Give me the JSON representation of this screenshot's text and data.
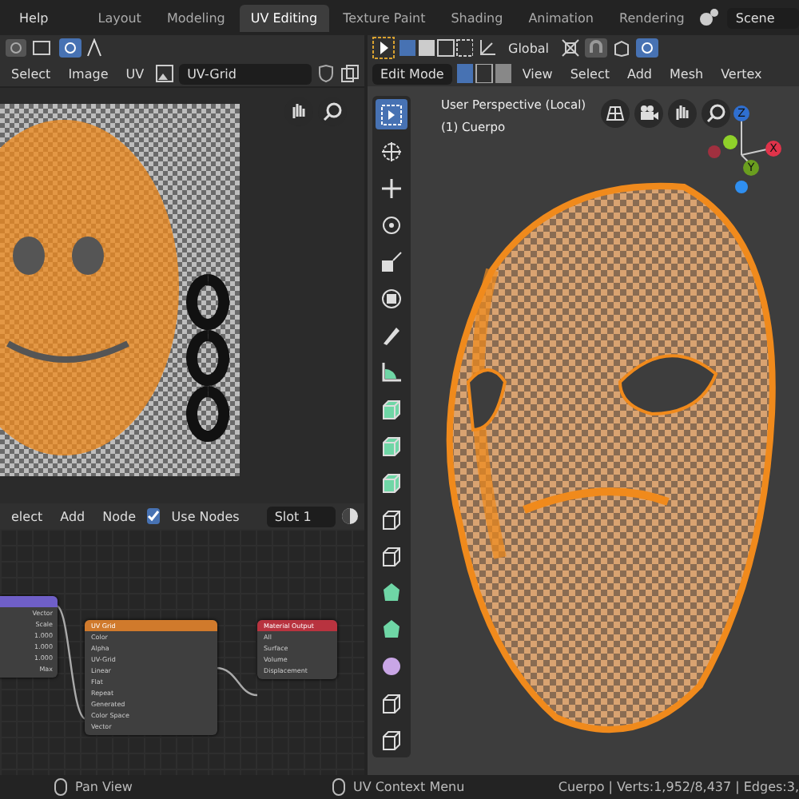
{
  "top_menu": "Help",
  "tabs": [
    {
      "label": "Layout",
      "selected": false
    },
    {
      "label": "Modeling",
      "selected": false
    },
    {
      "label": "UV Editing",
      "selected": true
    },
    {
      "label": "Texture Paint",
      "selected": false
    },
    {
      "label": "Shading",
      "selected": false
    },
    {
      "label": "Animation",
      "selected": false
    },
    {
      "label": "Rendering",
      "selected": false
    }
  ],
  "scene": "Scene",
  "uv_editor": {
    "menu": [
      "Select",
      "Image",
      "UV"
    ],
    "image_name": "UV-Grid"
  },
  "viewport": {
    "mode": "Edit Mode",
    "transform": "Global",
    "menu": [
      "View",
      "Select",
      "Add",
      "Mesh",
      "Vertex"
    ],
    "view_name": "User Perspective (Local)",
    "object": "(1) Cuerpo",
    "axes": [
      "Z",
      "X",
      "Y"
    ],
    "tools": [
      {
        "kind": "select",
        "selected": true
      },
      {
        "kind": "cursor",
        "selected": false
      },
      {
        "kind": "move",
        "selected": false
      },
      {
        "kind": "rotate",
        "selected": false
      },
      {
        "kind": "scale",
        "selected": false
      },
      {
        "kind": "transform",
        "selected": false
      },
      {
        "kind": "annotate",
        "selected": false
      },
      {
        "kind": "measure",
        "selected": false
      },
      {
        "kind": "extrude",
        "selected": false
      },
      {
        "kind": "inset",
        "selected": false
      },
      {
        "kind": "bevel",
        "selected": false
      },
      {
        "kind": "loopcut",
        "selected": false
      },
      {
        "kind": "knife",
        "selected": false
      },
      {
        "kind": "polybuild",
        "selected": false
      },
      {
        "kind": "spin",
        "selected": false
      },
      {
        "kind": "smooth",
        "selected": false
      },
      {
        "kind": "shear",
        "selected": false
      },
      {
        "kind": "rip",
        "selected": false
      }
    ]
  },
  "node_editor": {
    "menu": [
      "elect",
      "Add",
      "Node"
    ],
    "use_nodes": {
      "label": "Use Nodes",
      "checked": true
    },
    "slot": "Slot 1",
    "nodes": [
      {
        "kind": "mapping",
        "lines": [
          "Vector",
          "Scale",
          "1.000",
          "1.000",
          "1.000",
          "Max"
        ]
      },
      {
        "kind": "texture",
        "title": "UV Grid",
        "lines": [
          "Color",
          "Alpha",
          "UV-Grid",
          "Linear",
          "Flat",
          "Repeat",
          "Generated",
          "Color Space",
          "Vector"
        ]
      },
      {
        "kind": "output",
        "title": "Material Output",
        "lines": [
          "All",
          "Surface",
          "Volume",
          "Displacement"
        ]
      }
    ]
  },
  "status_bar": {
    "left": "Pan View",
    "middle": "UV Context Menu",
    "right": "Cuerpo | Verts:1,952/8,437 | Edges:3,"
  }
}
